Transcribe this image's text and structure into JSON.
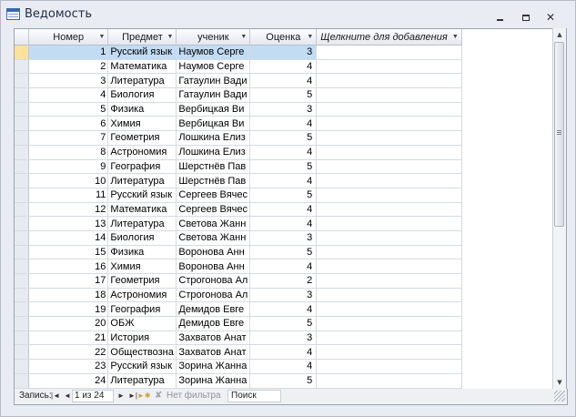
{
  "window": {
    "title": "Ведомость"
  },
  "grid": {
    "columns": [
      "Номер",
      "Предмет",
      "ученик",
      "Оценка"
    ],
    "add_column_label": "Щелкните для добавления",
    "rows": [
      {
        "num": "1",
        "subject": "Русский язык",
        "student": "Наумов Серге",
        "grade": "3"
      },
      {
        "num": "2",
        "subject": "Математика",
        "student": "Наумов Серге",
        "grade": "4"
      },
      {
        "num": "3",
        "subject": "Литература",
        "student": "Гатаулин Вади",
        "grade": "4"
      },
      {
        "num": "4",
        "subject": "Биология",
        "student": "Гатаулин Вади",
        "grade": "5"
      },
      {
        "num": "5",
        "subject": "Физика",
        "student": "Вербицкая Ви",
        "grade": "3"
      },
      {
        "num": "6",
        "subject": "Химия",
        "student": "Вербицкая Ви",
        "grade": "4"
      },
      {
        "num": "7",
        "subject": "Геометрия",
        "student": "Лошкина Елиз",
        "grade": "5"
      },
      {
        "num": "8",
        "subject": "Астрономия",
        "student": "Лошкина Елиз",
        "grade": "4"
      },
      {
        "num": "9",
        "subject": "География",
        "student": "Шерстнёв Пав",
        "grade": "5"
      },
      {
        "num": "10",
        "subject": "Литература",
        "student": "Шерстнёв Пав",
        "grade": "4"
      },
      {
        "num": "11",
        "subject": "Русский язык",
        "student": "Сергеев Вячес",
        "grade": "5"
      },
      {
        "num": "12",
        "subject": "Математика",
        "student": "Сергеев Вячес",
        "grade": "4"
      },
      {
        "num": "13",
        "subject": "Литература",
        "student": "Светова Жанн",
        "grade": "4"
      },
      {
        "num": "14",
        "subject": "Биология",
        "student": "Светова Жанн",
        "grade": "3"
      },
      {
        "num": "15",
        "subject": "Физика",
        "student": "Воронова Анн",
        "grade": "5"
      },
      {
        "num": "16",
        "subject": "Химия",
        "student": "Воронова Анн",
        "grade": "4"
      },
      {
        "num": "17",
        "subject": "Геометрия",
        "student": "Строгонова Ал",
        "grade": "2"
      },
      {
        "num": "18",
        "subject": "Астрономия",
        "student": "Строгонова Ал",
        "grade": "3"
      },
      {
        "num": "19",
        "subject": "География",
        "student": "Демидов Евге",
        "grade": "4"
      },
      {
        "num": "20",
        "subject": "ОБЖ",
        "student": "Демидов Евге",
        "grade": "5"
      },
      {
        "num": "21",
        "subject": "История",
        "student": "Захватов Анат",
        "grade": "3"
      },
      {
        "num": "22",
        "subject": "Обществозна",
        "student": "Захватов Анат",
        "grade": "4"
      },
      {
        "num": "23",
        "subject": "Русский язык",
        "student": "Зорина Жанна",
        "grade": "4"
      },
      {
        "num": "24",
        "subject": "Литература",
        "student": "Зорина Жанна",
        "grade": "5"
      }
    ]
  },
  "nav": {
    "record_label": "Запись:",
    "position": "1 из 24",
    "filter_label": "Нет фильтра",
    "search_label": "Поиск",
    "icons": {
      "first": "first-record-icon",
      "prev": "prev-record-icon",
      "next": "next-record-icon",
      "last": "last-record-icon",
      "new": "new-record-icon",
      "filter": "filter-icon"
    }
  },
  "colors": {
    "selected_row": "#c2dcf4",
    "current_selector": "#fce29b"
  }
}
